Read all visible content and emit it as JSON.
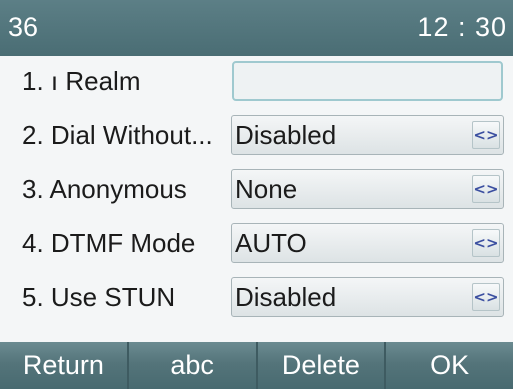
{
  "header": {
    "account": "36",
    "time": "12 : 30"
  },
  "rows": [
    {
      "label": "1. ı Realm",
      "value": ""
    },
    {
      "label": "2. Dial Without...",
      "value": "Disabled"
    },
    {
      "label": "3. Anonymous",
      "value": "None"
    },
    {
      "label": "4. DTMF Mode",
      "value": "AUTO"
    },
    {
      "label": "5. Use STUN",
      "value": "Disabled"
    }
  ],
  "switch_glyph": "<>",
  "softkeys": [
    "Return",
    "abc",
    "Delete",
    "OK"
  ]
}
